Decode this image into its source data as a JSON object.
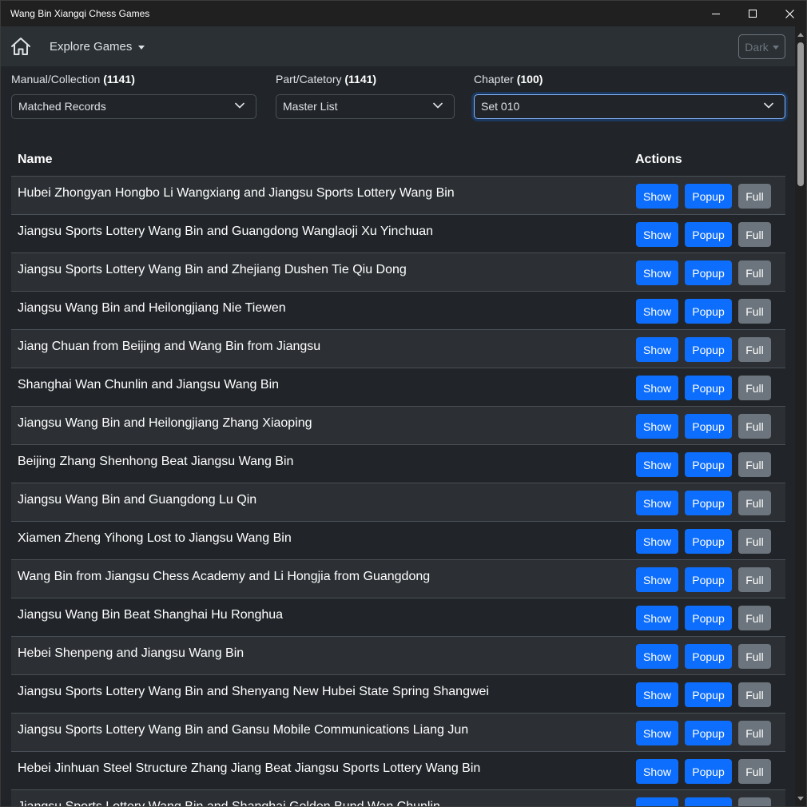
{
  "window": {
    "title": "Wang Bin Xiangqi Chess Games"
  },
  "navbar": {
    "explore_label": "Explore Games",
    "theme_label": "Dark"
  },
  "filters": {
    "manual": {
      "label": "Manual/Collection",
      "count": "(1141)",
      "value": "Matched Records"
    },
    "part": {
      "label": "Part/Catetory",
      "count": "(1141)",
      "value": "Master List"
    },
    "chapter": {
      "label": "Chapter",
      "count": "(100)",
      "value": "Set 010"
    }
  },
  "table": {
    "headers": {
      "name": "Name",
      "actions": "Actions"
    },
    "buttons": {
      "show": "Show",
      "popup": "Popup",
      "full": "Full"
    },
    "rows": [
      "Hubei Zhongyan Hongbo Li Wangxiang and Jiangsu Sports Lottery Wang Bin",
      "Jiangsu Sports Lottery Wang Bin and Guangdong Wanglaoji Xu Yinchuan",
      "Jiangsu Sports Lottery Wang Bin and Zhejiang Dushen Tie Qiu Dong",
      "Jiangsu Wang Bin and Heilongjiang Nie Tiewen",
      "Jiang Chuan from Beijing and Wang Bin from Jiangsu",
      "Shanghai Wan Chunlin and Jiangsu Wang Bin",
      "Jiangsu Wang Bin and Heilongjiang Zhang Xiaoping",
      "Beijing Zhang Shenhong Beat Jiangsu Wang Bin",
      "Jiangsu Wang Bin and Guangdong Lu Qin",
      "Xiamen Zheng Yihong Lost to Jiangsu Wang Bin",
      "Wang Bin from Jiangsu Chess Academy and Li Hongjia from Guangdong",
      "Jiangsu Wang Bin Beat Shanghai Hu Ronghua",
      "Hebei Shenpeng and Jiangsu Wang Bin",
      "Jiangsu Sports Lottery Wang Bin and Shenyang New Hubei State Spring Shangwei",
      "Jiangsu Sports Lottery Wang Bin and Gansu Mobile Communications Liang Jun",
      "Hebei Jinhuan Steel Structure Zhang Jiang Beat Jiangsu Sports Lottery Wang Bin",
      "Jiangsu Sports Lottery Wang Bin and Shanghai Golden Bund Wan Chunlin"
    ]
  },
  "icons": {
    "home": "home-icon",
    "minimize": "minimize-icon",
    "maximize": "maximize-icon",
    "close": "close-icon",
    "chevron": "chevron-down-icon"
  },
  "colors": {
    "primary": "#0d6efd",
    "secondary": "#6c757d",
    "background": "#212529",
    "navbar": "#2b3035",
    "stripe": "#2c3034"
  }
}
